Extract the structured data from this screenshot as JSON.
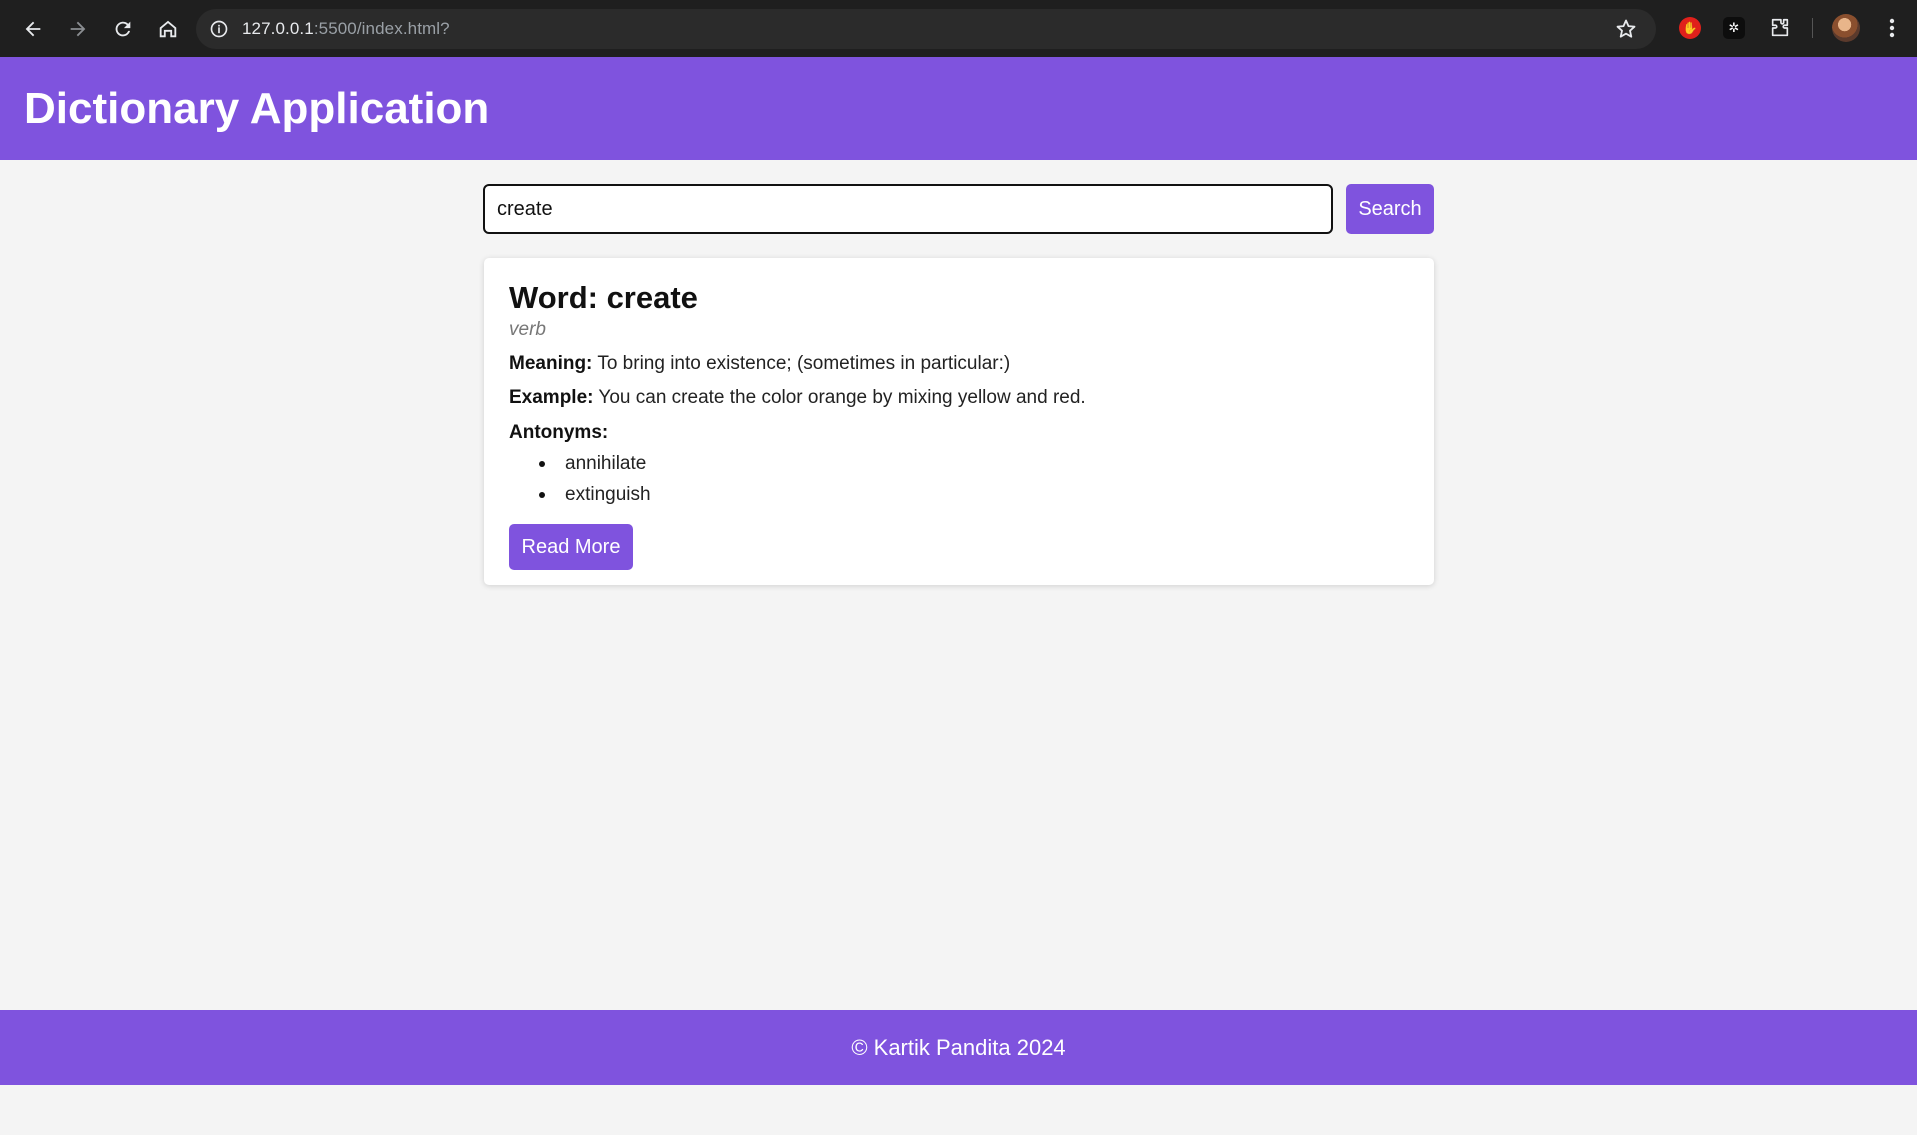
{
  "browser": {
    "url_host": "127.0.0.1",
    "url_path": ":5500/index.html?"
  },
  "header": {
    "title": "Dictionary Application"
  },
  "search": {
    "value": "create",
    "button_label": "Search"
  },
  "result": {
    "word_title": "Word: create",
    "part_of_speech": "verb",
    "meaning_label": "Meaning:",
    "meaning_text": "To bring into existence; (sometimes in particular:)",
    "example_label": "Example:",
    "example_text": "You can create the color orange by mixing yellow and red.",
    "antonyms_label": "Antonyms:",
    "antonyms": [
      "annihilate",
      "extinguish"
    ],
    "read_more_label": "Read More"
  },
  "footer": {
    "text": "© Kartik Pandita 2024"
  },
  "colors": {
    "brand": "#7f53de",
    "page_bg": "#f4f4f4",
    "chrome_bg": "#1f1f1f"
  }
}
